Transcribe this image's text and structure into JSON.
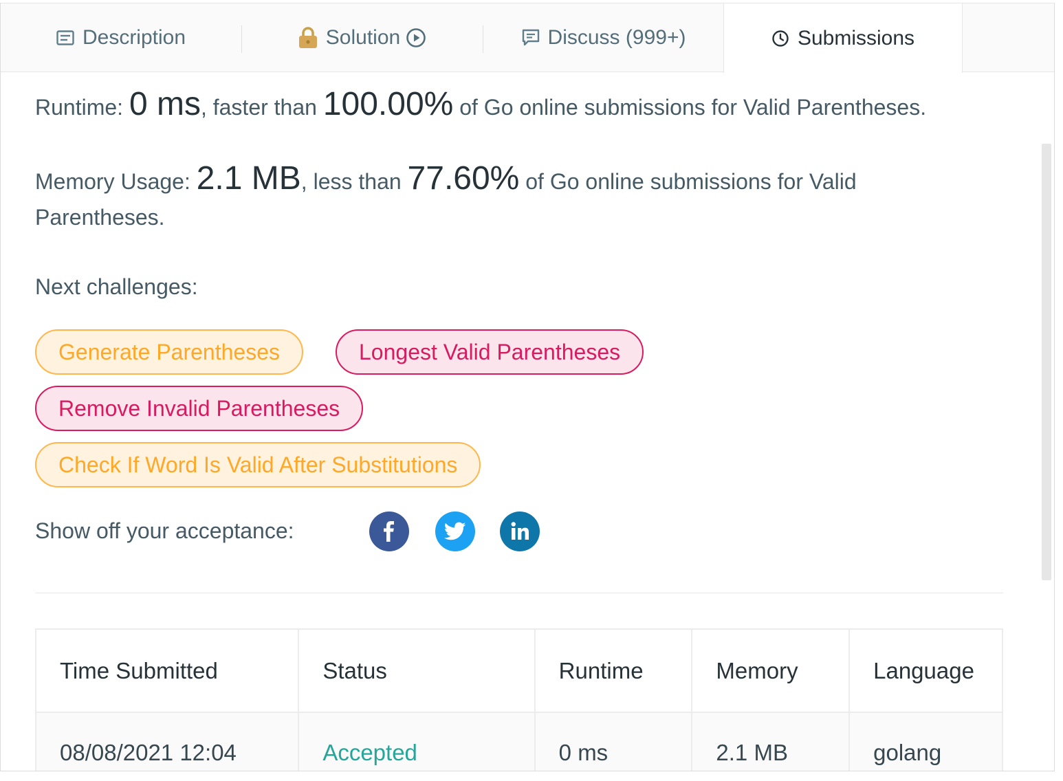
{
  "tabs": [
    {
      "label": "Description",
      "icon": "description-icon"
    },
    {
      "label": "Solution",
      "icon": "lock-icon",
      "icon_after": "play-circle-icon"
    },
    {
      "label": "Discuss (999+)",
      "icon": "comment-icon"
    },
    {
      "label": "Submissions",
      "icon": "clock-icon",
      "active": true
    }
  ],
  "runtime": {
    "prefix": "Runtime: ",
    "value": "0 ms",
    "middle": ", faster than ",
    "percent": "100.00%",
    "suffix": " of Go online submissions for Valid Parentheses."
  },
  "memory": {
    "prefix": "Memory Usage: ",
    "value": "2.1 MB",
    "middle": ", less than ",
    "percent": "77.60%",
    "suffix": " of Go online submissions for Valid Parentheses."
  },
  "next_challenges": {
    "label": "Next challenges:",
    "items": [
      {
        "label": "Generate Parentheses",
        "difficulty": "medium"
      },
      {
        "label": "Longest Valid Parentheses",
        "difficulty": "hard"
      },
      {
        "label": "Remove Invalid Parentheses",
        "difficulty": "hard"
      },
      {
        "label": "Check If Word Is Valid After Substitutions",
        "difficulty": "medium"
      }
    ]
  },
  "share": {
    "label": "Show off your acceptance:",
    "buttons": [
      {
        "icon": "facebook-icon",
        "color": "#3b5998"
      },
      {
        "icon": "twitter-icon",
        "color": "#1da1f2"
      },
      {
        "icon": "linkedin-icon",
        "color": "#0e76a8"
      }
    ]
  },
  "table": {
    "headers": [
      "Time Submitted",
      "Status",
      "Runtime",
      "Memory",
      "Language"
    ],
    "rows": [
      {
        "time": "08/08/2021 12:04",
        "status": "Accepted",
        "runtime": "0 ms",
        "memory": "2.1 MB",
        "language": "golang"
      }
    ]
  },
  "colors": {
    "accepted": "#26a69a",
    "medium": "#ffa726",
    "hard": "#d81b60"
  }
}
